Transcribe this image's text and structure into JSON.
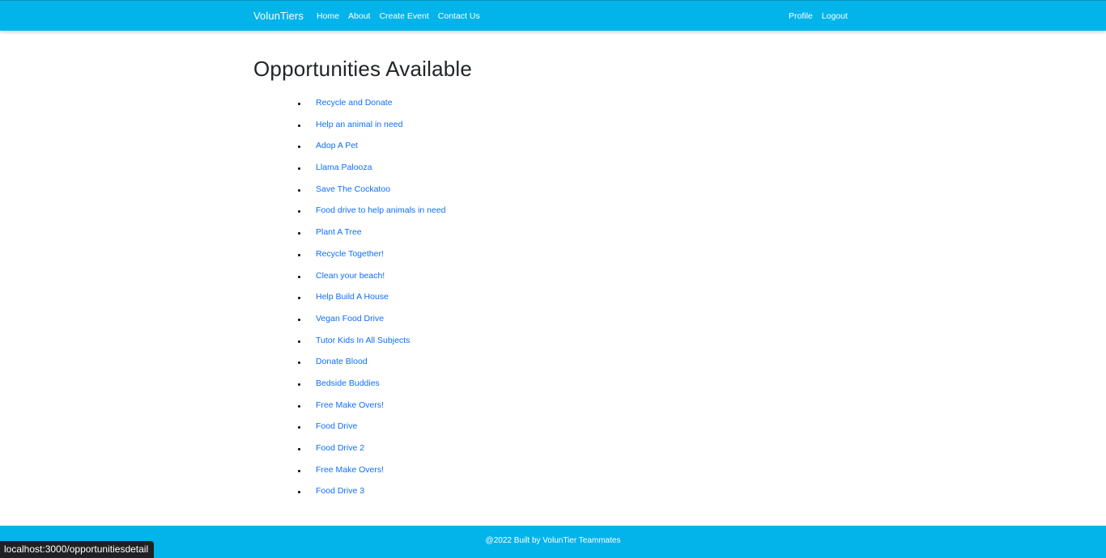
{
  "navbar": {
    "brand": "VolunTiers",
    "left_links": [
      "Home",
      "About",
      "Create Event",
      "Contact Us"
    ],
    "right_links": [
      "Profile",
      "Logout"
    ],
    "color": "#03b4ea"
  },
  "page": {
    "title": "Opportunities Available",
    "opportunities": [
      "Recycle and Donate",
      "Help an animal in need",
      "Adop A Pet",
      "Llama Palooza",
      "Save The Cockatoo",
      "Food drive to help animals in need",
      "Plant A Tree",
      "Recycle Together!",
      "Clean your beach!",
      "Help Build A House",
      "Vegan Food Drive",
      "Tutor Kids In All Subjects",
      "Donate Blood",
      "Bedside Buddies",
      "Free Make Overs!",
      "Food Drive",
      "Food Drive 2",
      "Free Make Overs!",
      "Food Drive 3"
    ],
    "link_color": "#0d6efd"
  },
  "footer": {
    "text": "@2022 Built by VolunTier Teammates"
  },
  "status_bar": {
    "url": "localhost:3000/opportunitiesdetail"
  }
}
